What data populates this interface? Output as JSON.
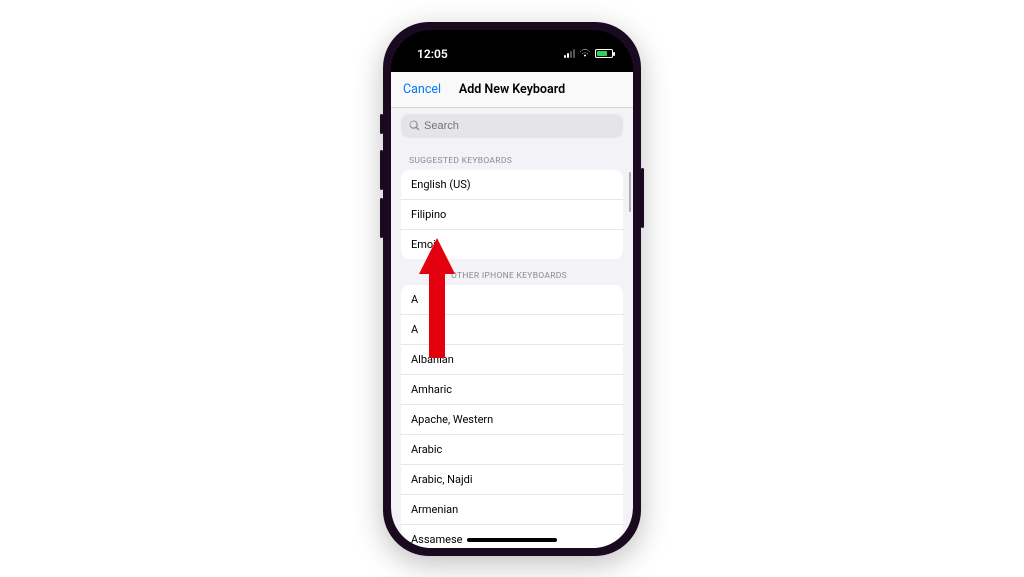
{
  "status": {
    "time": "12:05"
  },
  "nav": {
    "cancel": "Cancel",
    "title": "Add New Keyboard"
  },
  "search": {
    "placeholder": "Search"
  },
  "sections": {
    "suggested": {
      "header": "Suggested Keyboards",
      "items": [
        "English (US)",
        "Filipino",
        "Emoji"
      ]
    },
    "other": {
      "header": "Other iPhone Keyboards",
      "items": [
        "A",
        "A",
        "Albanian",
        "Amharic",
        "Apache, Western",
        "Arabic",
        "Arabic, Najdi",
        "Armenian",
        "Assamese"
      ]
    }
  }
}
